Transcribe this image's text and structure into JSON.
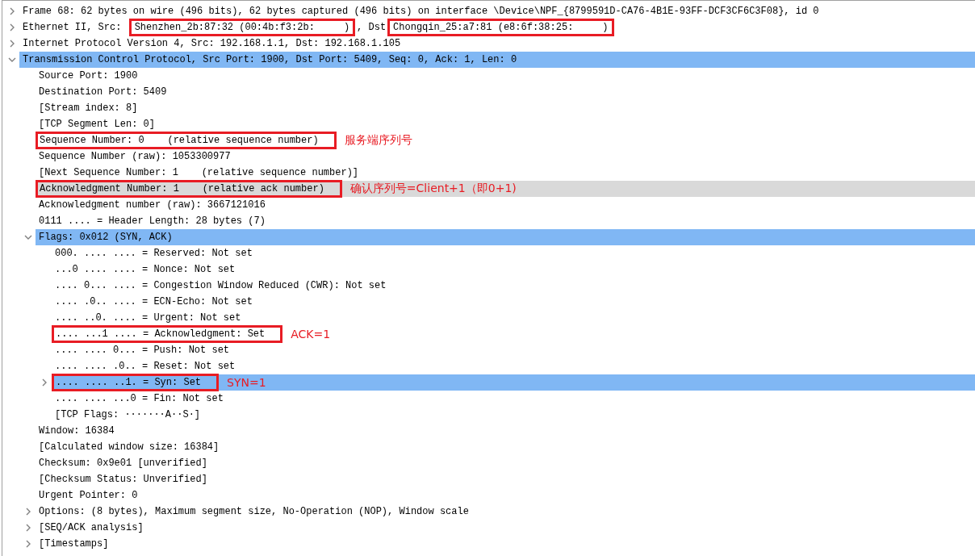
{
  "tree": [
    {
      "text": "Frame 68: 62 bytes on wire (496 bits), 62 bytes captured (496 bits) on interface \\Device\\NPF_{8799591D-CA76-4B1E-93FF-DCF3CF6C3F08}, id 0",
      "expanded": false,
      "selected": false,
      "highlighted": false,
      "boxed": false
    },
    {
      "parts": [
        {
          "kind": "text",
          "text": "Ethernet II, Src: "
        },
        {
          "kind": "box",
          "parts": [
            {
              "kind": "text",
              "text": "Shenzhen_2b:87:32 (00:4b:f3:2b:"
            },
            {
              "kind": "redaction"
            },
            {
              "kind": "text",
              "text": ")"
            }
          ]
        },
        {
          "kind": "text",
          "text": ", Dst"
        },
        {
          "kind": "box",
          "parts": [
            {
              "kind": "text",
              "text": "Chongqin_25:a7:81 (e8:6f:38:25:"
            },
            {
              "kind": "redaction"
            },
            {
              "kind": "text",
              "text": ")"
            }
          ]
        }
      ],
      "expanded": false,
      "selected": false,
      "highlighted": false
    },
    {
      "text": "Internet Protocol Version 4, Src: 192.168.1.1, Dst: 192.168.1.105",
      "expanded": false,
      "selected": false,
      "highlighted": false,
      "boxed": false
    },
    {
      "text": "Transmission Control Protocol, Src Port: 1900, Dst Port: 5409, Seq: 0, Ack: 1, Len: 0",
      "expanded": true,
      "selected": true,
      "highlighted": false,
      "boxed": false,
      "children": [
        {
          "text": "Source Port: 1900",
          "selected": false,
          "highlighted": false,
          "boxed": false
        },
        {
          "text": "Destination Port: 5409",
          "selected": false,
          "highlighted": false,
          "boxed": false
        },
        {
          "text": "[Stream index: 8]",
          "selected": false,
          "highlighted": false,
          "boxed": false
        },
        {
          "text": "[TCP Segment Len: 0]",
          "selected": false,
          "highlighted": false,
          "boxed": false
        },
        {
          "text": "Sequence Number: 0    (relative sequence number)",
          "selected": false,
          "highlighted": false,
          "boxed": true,
          "note": "服务端序列号"
        },
        {
          "text": "Sequence Number (raw): 1053300977",
          "selected": false,
          "highlighted": false,
          "boxed": false
        },
        {
          "text": "[Next Sequence Number: 1    (relative sequence number)]",
          "selected": false,
          "highlighted": false,
          "boxed": false
        },
        {
          "text": "Acknowledgment Number: 1    (relative ack number)",
          "selected": false,
          "highlighted": true,
          "boxed": true,
          "note": "确认序列号=Client+1（即0+1)"
        },
        {
          "text": "Acknowledgment number (raw): 3667121016",
          "selected": false,
          "highlighted": false,
          "boxed": false
        },
        {
          "text": "0111 .... = Header Length: 28 bytes (7)",
          "selected": false,
          "highlighted": false,
          "boxed": false
        },
        {
          "text": "Flags: 0x012 (SYN, ACK)",
          "expanded": true,
          "selected": true,
          "highlighted": false,
          "boxed": false,
          "children": [
            {
              "text": "000. .... .... = Reserved: Not set",
              "selected": false,
              "highlighted": false,
              "boxed": false
            },
            {
              "text": "...0 .... .... = Nonce: Not set",
              "selected": false,
              "highlighted": false,
              "boxed": false
            },
            {
              "text": ".... 0... .... = Congestion Window Reduced (CWR): Not set",
              "selected": false,
              "highlighted": false,
              "boxed": false
            },
            {
              "text": ".... .0.. .... = ECN-Echo: Not set",
              "selected": false,
              "highlighted": false,
              "boxed": false
            },
            {
              "text": ".... ..0. .... = Urgent: Not set",
              "selected": false,
              "highlighted": false,
              "boxed": false
            },
            {
              "text": ".... ...1 .... = Acknowledgment: Set",
              "selected": false,
              "highlighted": false,
              "boxed": true,
              "note": "ACK=1"
            },
            {
              "text": ".... .... 0... = Push: Not set",
              "selected": false,
              "highlighted": false,
              "boxed": false
            },
            {
              "text": ".... .... .0.. = Reset: Not set",
              "selected": false,
              "highlighted": false,
              "boxed": false
            },
            {
              "text": ".... .... ..1. = Syn: Set",
              "expanded": false,
              "selected": true,
              "highlighted": false,
              "boxed": true,
              "note": "SYN=1"
            },
            {
              "text": ".... .... ...0 = Fin: Not set",
              "selected": false,
              "highlighted": false,
              "boxed": false
            },
            {
              "text": "[TCP Flags: ·······A··S·]",
              "selected": false,
              "highlighted": false,
              "boxed": false
            }
          ]
        },
        {
          "text": "Window: 16384",
          "selected": false,
          "highlighted": false,
          "boxed": false
        },
        {
          "text": "[Calculated window size: 16384]",
          "selected": false,
          "highlighted": false,
          "boxed": false
        },
        {
          "text": "Checksum: 0x9e01 [unverified]",
          "selected": false,
          "highlighted": false,
          "boxed": false
        },
        {
          "text": "[Checksum Status: Unverified]",
          "selected": false,
          "highlighted": false,
          "boxed": false
        },
        {
          "text": "Urgent Pointer: 0",
          "selected": false,
          "highlighted": false,
          "boxed": false
        },
        {
          "text": "Options: (8 bytes), Maximum segment size, No-Operation (NOP), Window scale",
          "expanded": false,
          "selected": false,
          "highlighted": false,
          "boxed": false
        },
        {
          "text": "[SEQ/ACK analysis]",
          "expanded": false,
          "selected": false,
          "highlighted": false,
          "boxed": false
        },
        {
          "text": "[Timestamps]",
          "expanded": false,
          "selected": false,
          "highlighted": false,
          "boxed": false
        }
      ]
    }
  ]
}
